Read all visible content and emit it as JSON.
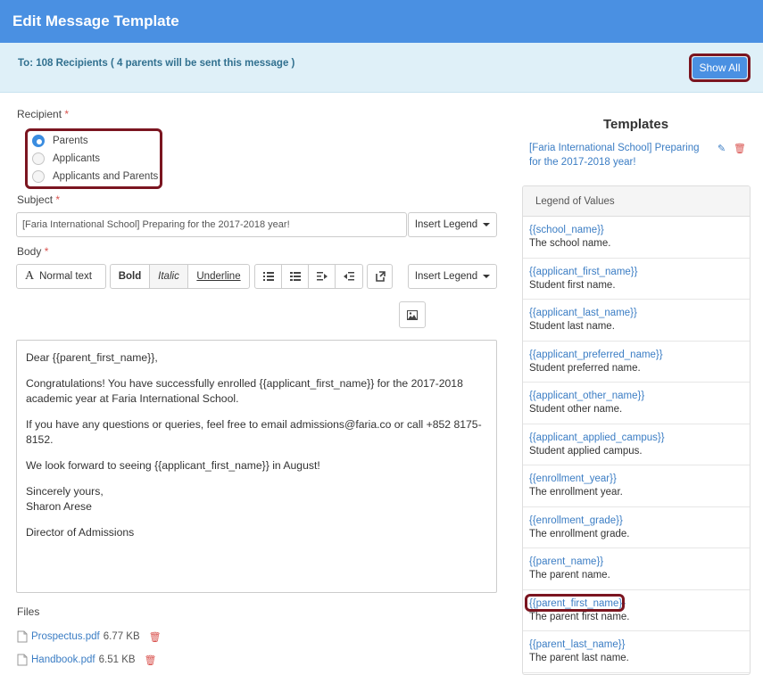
{
  "header": {
    "title": "Edit Message Template"
  },
  "banner": {
    "recipients_text": "To: 108 Recipients ( 4 parents will be sent this message )",
    "show_all_label": "Show All"
  },
  "recipient": {
    "label": "Recipient",
    "required_mark": "*",
    "options": [
      {
        "label": "Parents",
        "selected": true
      },
      {
        "label": "Applicants",
        "selected": false
      },
      {
        "label": "Applicants and Parents",
        "selected": false
      }
    ]
  },
  "subject": {
    "label": "Subject",
    "required_mark": "*",
    "value": "[Faria International School] Preparing for the 2017-2018 year!",
    "insert_legend_label": "Insert Legend"
  },
  "body": {
    "label": "Body",
    "required_mark": "*",
    "toolbar": {
      "font_style": "Normal text",
      "bold": "Bold",
      "italic": "Italic",
      "underline": "Underline",
      "insert_legend_label": "Insert Legend"
    },
    "paragraphs": [
      "Dear {{parent_first_name}},",
      "Congratulations! You have successfully enrolled {{applicant_first_name}} for the 2017-2018 academic year at Faria International School.",
      "If you have any questions or queries, feel free to email admissions@faria.co or call +852 8175-8152.",
      "We look forward to seeing {{applicant_first_name}} in August!",
      "Sincerely yours,",
      "Sharon Arese",
      "Director of Admissions"
    ]
  },
  "files": {
    "label": "Files",
    "items": [
      {
        "name": "Prospectus.pdf",
        "size": "6.77 KB"
      },
      {
        "name": "Handbook.pdf",
        "size": "6.51 KB"
      }
    ]
  },
  "templates": {
    "title": "Templates",
    "items": [
      {
        "name": "[Faria International School] Preparing for the 2017-2018 year!"
      }
    ]
  },
  "legend": {
    "title": "Legend of Values",
    "items": [
      {
        "key": "{{school_name}}",
        "desc": "The school name."
      },
      {
        "key": "{{applicant_first_name}}",
        "desc": "Student first name."
      },
      {
        "key": "{{applicant_last_name}}",
        "desc": "Student last name."
      },
      {
        "key": "{{applicant_preferred_name}}",
        "desc": "Student preferred name."
      },
      {
        "key": "{{applicant_other_name}}",
        "desc": "Student other name."
      },
      {
        "key": "{{applicant_applied_campus}}",
        "desc": "Student applied campus."
      },
      {
        "key": "{{enrollment_year}}",
        "desc": "The enrollment year."
      },
      {
        "key": "{{enrollment_grade}}",
        "desc": "The enrollment grade."
      },
      {
        "key": "{{parent_name}}",
        "desc": "The parent name."
      },
      {
        "key": "{{parent_first_name}}",
        "desc": "The parent first name."
      },
      {
        "key": "{{parent_last_name}}",
        "desc": "The parent last name."
      }
    ]
  },
  "colors": {
    "header": "#4a90e2",
    "banner": "#dff0f8",
    "highlight_border": "#7b1520",
    "link": "#3b7dc4",
    "danger": "#d9534f"
  }
}
